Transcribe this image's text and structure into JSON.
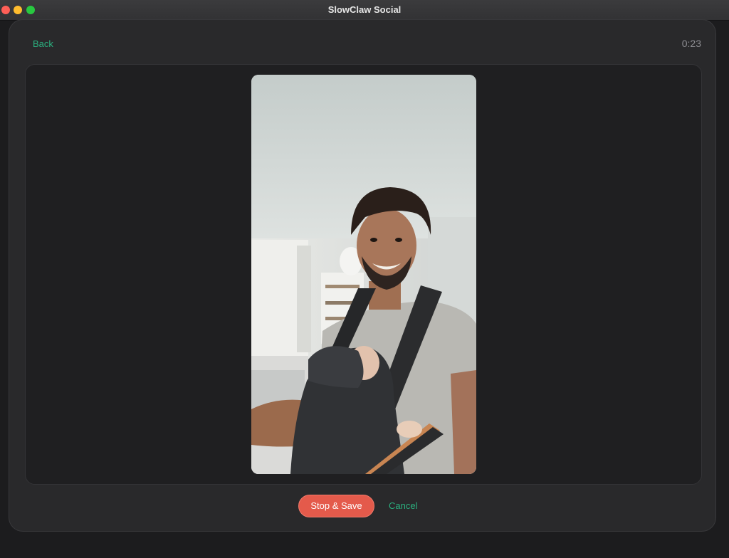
{
  "window": {
    "title": "SlowClaw Social"
  },
  "header": {
    "back_label": "Back",
    "timer": "0:23"
  },
  "preview": {
    "description_icon": "camera-preview"
  },
  "actions": {
    "stop_save_label": "Stop & Save",
    "cancel_label": "Cancel"
  },
  "colors": {
    "accent": "#2bb07f",
    "stop": "#e45a4b"
  }
}
